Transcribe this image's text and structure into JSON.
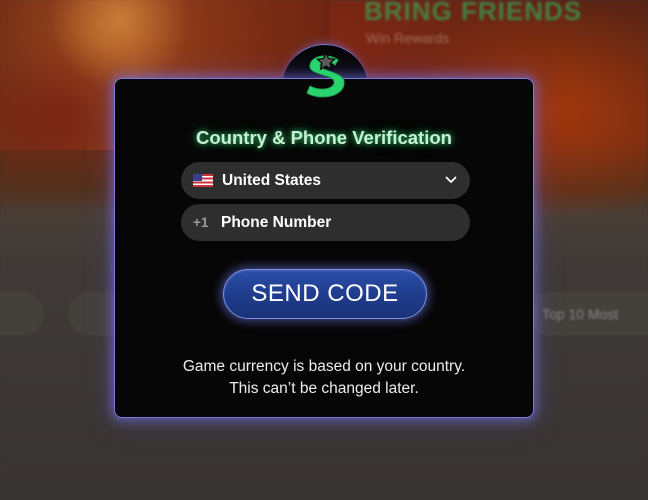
{
  "background": {
    "promo_title": "BRING FRIENDS",
    "promo_subtitle": "Win Rewards",
    "chips": [
      "",
      "",
      "Top 10 Most"
    ]
  },
  "modal": {
    "logo_icon": "stake-s-star-logo",
    "title": "Country & Phone Verification",
    "country_select": {
      "flag_icon": "us-flag-icon",
      "value": "United States",
      "chevron_icon": "chevron-down-icon"
    },
    "phone_field": {
      "prefix": "+1",
      "placeholder": "Phone Number"
    },
    "send_button": "SEND CODE",
    "note_line_1": "Game currency is based on your country.",
    "note_line_2": "This can’t be changed later."
  },
  "colors": {
    "accent_green": "#27d46d",
    "modal_border": "#7b78d9",
    "button_blue": "#1f3c8b"
  }
}
